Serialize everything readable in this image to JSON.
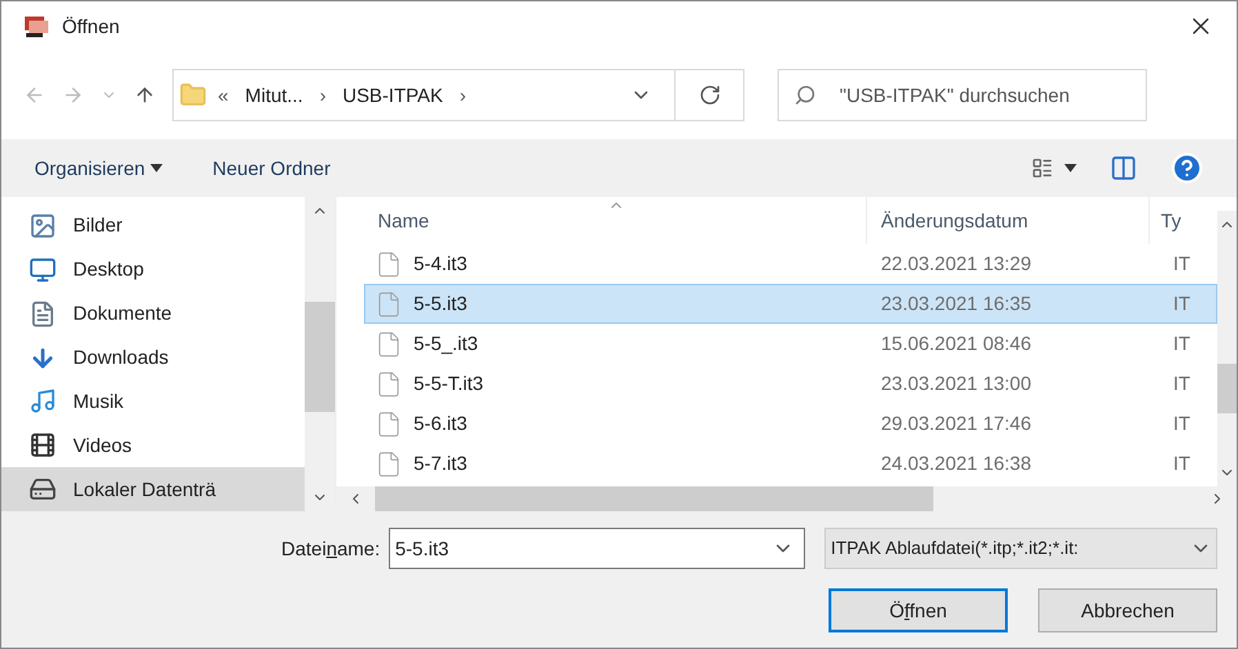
{
  "window": {
    "title": "Öffnen"
  },
  "address": {
    "overflow": "«",
    "crumbs": [
      "Mitut...",
      "USB-ITPAK"
    ],
    "separator": "›"
  },
  "search": {
    "placeholder": "\"USB-ITPAK\" durchsuchen"
  },
  "toolbar": {
    "organize": "Organisieren",
    "new_folder": "Neuer Ordner"
  },
  "sidebar": {
    "items": [
      {
        "label": "Bilder",
        "kind": "pictures",
        "selected": false
      },
      {
        "label": "Desktop",
        "kind": "desktop",
        "selected": false
      },
      {
        "label": "Dokumente",
        "kind": "documents",
        "selected": false
      },
      {
        "label": "Downloads",
        "kind": "downloads",
        "selected": false
      },
      {
        "label": "Musik",
        "kind": "music",
        "selected": false
      },
      {
        "label": "Videos",
        "kind": "videos",
        "selected": false
      },
      {
        "label": "Lokaler Datenträ",
        "kind": "drive",
        "selected": true
      }
    ]
  },
  "file_list": {
    "columns": [
      "Name",
      "Änderungsdatum",
      "Ty"
    ],
    "rows": [
      {
        "name": "5-4.it3",
        "date": "22.03.2021 13:29",
        "type": "IT",
        "selected": false
      },
      {
        "name": "5-5.it3",
        "date": "23.03.2021 16:35",
        "type": "IT",
        "selected": true
      },
      {
        "name": "5-5_.it3",
        "date": "15.06.2021 08:46",
        "type": "IT",
        "selected": false
      },
      {
        "name": "5-5-T.it3",
        "date": "23.03.2021 13:00",
        "type": "IT",
        "selected": false
      },
      {
        "name": "5-6.it3",
        "date": "29.03.2021 17:46",
        "type": "IT",
        "selected": false
      },
      {
        "name": "5-7.it3",
        "date": "24.03.2021 16:38",
        "type": "IT",
        "selected": false
      }
    ]
  },
  "footer": {
    "filename_label": {
      "before": "Datei",
      "accesskey": "n",
      "after": "ame:"
    },
    "filename": "5-5.it3",
    "filetype": "ITPAK Ablaufdatei(*.itp;*.it2;*.it:",
    "open_button": {
      "before": "Ö",
      "accesskey": "f",
      "after": "fnen"
    },
    "cancel_button": "Abbrechen"
  }
}
